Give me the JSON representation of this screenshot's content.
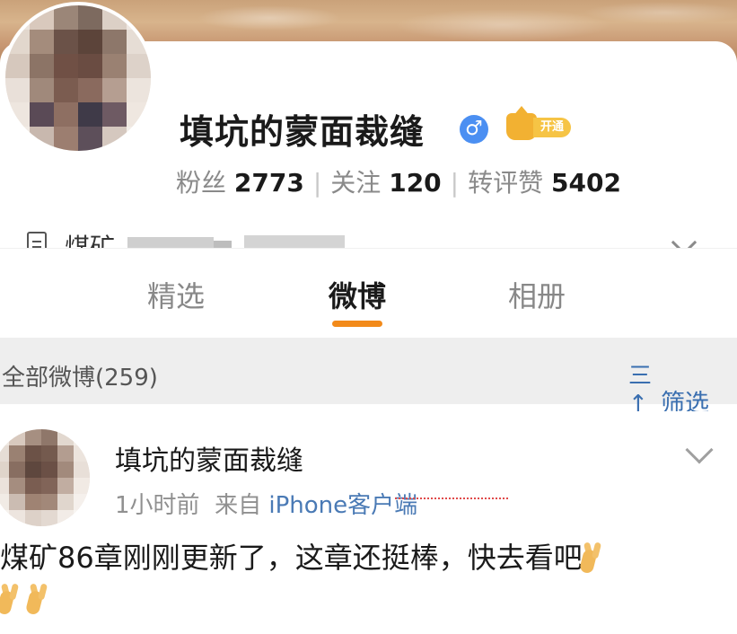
{
  "profile": {
    "username": "填坑的蒙面裁缝",
    "gender_icon": "male-icon",
    "vip_label": "开通",
    "stats": [
      {
        "label": "粉丝",
        "value": "2773"
      },
      {
        "label": "关注",
        "value": "120"
      },
      {
        "label": "转评赞",
        "value": "5402"
      }
    ],
    "bio_visible_start": "煤矿",
    "bio_visible_mid": "、"
  },
  "tabs": [
    {
      "label": "精选",
      "active": false
    },
    {
      "label": "微博",
      "active": true
    },
    {
      "label": "相册",
      "active": false
    }
  ],
  "filter_bar": {
    "count_label": "全部微博(259)",
    "filter_icon": "三↑",
    "filter_label": "筛选"
  },
  "post": {
    "author": "填坑的蒙面裁缝",
    "time": "1小时前",
    "source_prefix": "来自",
    "source": "iPhone客户端",
    "content": "煤矿86章刚刚更新了，这章还挺棒，快去看吧"
  },
  "colors": {
    "accent": "#f28a1a",
    "link": "#3a6fb0",
    "gender": "#4b8ff2"
  }
}
